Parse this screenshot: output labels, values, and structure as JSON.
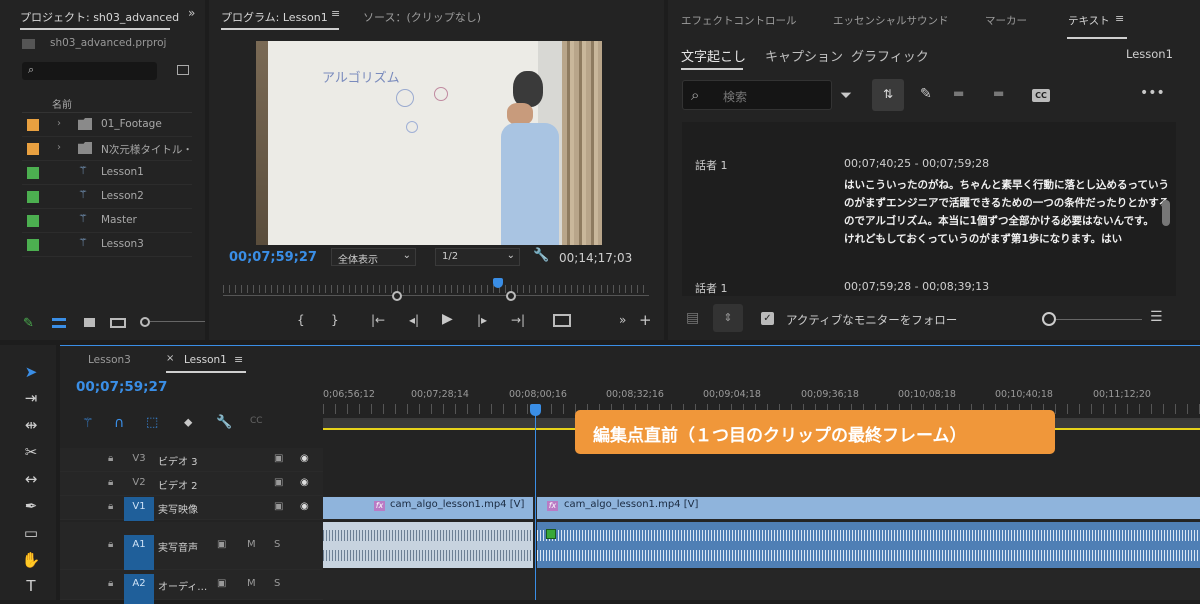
{
  "project": {
    "tab": "プロジェクト: sh03_advanced",
    "file": "sh03_advanced.prproj",
    "col_name": "名前",
    "items": [
      {
        "label": "01_Footage",
        "color": "#e8a040",
        "type": "folder"
      },
      {
        "label": "N次元様タイトル・ロゴ",
        "color": "#e8a040",
        "type": "folder"
      },
      {
        "label": "Lesson1",
        "color": "#4caf50",
        "type": "sequence"
      },
      {
        "label": "Lesson2",
        "color": "#4caf50",
        "type": "sequence"
      },
      {
        "label": "Master",
        "color": "#4caf50",
        "type": "sequence"
      },
      {
        "label": "Lesson3",
        "color": "#4caf50",
        "type": "sequence"
      }
    ]
  },
  "program": {
    "tab": "プログラム: Lesson1",
    "source_tab": "ソース：(クリップなし)",
    "timecode_current": "00;07;59;27",
    "timecode_total": "00;14;17;03",
    "zoom": "全体表示",
    "quality": "1/2",
    "board_text": "アルゴリズム"
  },
  "text_panel": {
    "tabs": [
      "エフェクトコントロール",
      "エッセンシャルサウンド",
      "マーカー",
      "テキスト"
    ],
    "subtabs": [
      "文字起こし",
      "キャプション",
      "グラフィック"
    ],
    "sequence": "Lesson1",
    "search_placeholder": "検索",
    "entries": [
      {
        "speaker": "話者 1",
        "time": "00;07;40;25 - 00;07;59;28",
        "lines": [
          "はいこういったのがね。ちゃんと素早く行動に落とし込めるっていう",
          "のがまずエンジニアで活躍できるための一つの条件だったりとかする",
          "のでアルゴリズム。本当に1個ずつ全部かける必要はないんです。",
          "けれどもしておくっていうのがまず第1歩になります。はい"
        ]
      },
      {
        "speaker": "話者 1",
        "time": "00;07;59;28 - 00;08;39;13",
        "lines": []
      }
    ],
    "follow_label": "アクティブなモニターをフォロー"
  },
  "timeline": {
    "tabs": [
      "Lesson3",
      "Lesson1"
    ],
    "timecode": "00;07;59;27",
    "ruler": [
      "0;06;56;12",
      "00;07;28;14",
      "00;08;00;16",
      "00;08;32;16",
      "00;09;04;18",
      "00;09;36;18",
      "00;10;08;18",
      "00;10;40;18",
      "00;11;12;20"
    ],
    "tracks": [
      {
        "id": "V3",
        "name": "ビデオ 3"
      },
      {
        "id": "V2",
        "name": "ビデオ 2"
      },
      {
        "id": "V1",
        "name": "実写映像"
      },
      {
        "id": "A1",
        "name": "実写音声",
        "m": "M",
        "s": "S"
      },
      {
        "id": "A2",
        "name": "オーディ…",
        "m": "M",
        "s": "S"
      }
    ],
    "clip_left": "cam_algo_lesson1.mp4 [V]",
    "clip_right": "cam_algo_lesson1.mp4 [V]",
    "fx": "fx",
    "callout": "編集点直前（１つ目のクリップの最終フレーム）"
  },
  "colors": {
    "accent": "#3a8ee6",
    "callout": "#f0973a",
    "clip_video": "#8fb4dc",
    "clip_audio": "#4f7fb5"
  }
}
